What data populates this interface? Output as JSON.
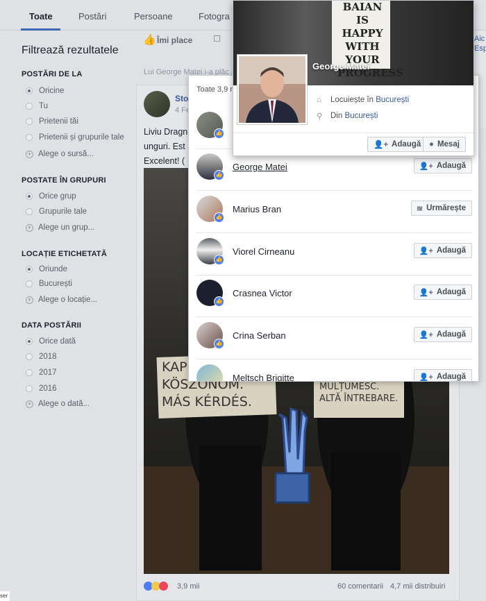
{
  "tabs": [
    "Toate",
    "Postări",
    "Persoane",
    "Fotogra"
  ],
  "sidebar": {
    "title": "Filtrează rezultatele",
    "sections": [
      {
        "heading": "POSTĂRI DE LA",
        "options": [
          "Oricine",
          "Tu",
          "Prietenii tăi",
          "Prietenii și grupurile tale"
        ],
        "more": "Alege o sursă..."
      },
      {
        "heading": "POSTATE ÎN GRUPURI",
        "options": [
          "Orice grup",
          "Grupurile tale"
        ],
        "more": "Alege un grup..."
      },
      {
        "heading": "LOCAȚIE ETICHETATĂ",
        "options": [
          "Oriunde",
          "București"
        ],
        "more": "Alege o locație..."
      },
      {
        "heading": "DATA POSTĂRII",
        "options": [
          "Orice dată",
          "2018",
          "2017",
          "2016"
        ],
        "more": "Alege o dată..."
      }
    ]
  },
  "post": {
    "like_label": "Îmi place",
    "shared_by": "Lui George Matei i-a plăc",
    "author_fragment": "Sto",
    "date_fragment": "4 Fe",
    "text_lines": [
      "Liviu Dragn",
      "unguri. Est",
      "Excelent! ("
    ],
    "sign_left": [
      "KAP",
      "KÖSZÖNÖM.",
      "MÁS KÉRDÉS."
    ],
    "sign_right": [
      "MULȚUMESC.",
      "ALTĂ ÎNTREBARE."
    ],
    "reactions_count": "3,9 mii",
    "comments": "60 comentarii",
    "shares": "4,7 mii distribuiri"
  },
  "right_column": {
    "line1": "Aic",
    "line2": "Esp"
  },
  "likers": {
    "tab_label": "Toate 3,9 m",
    "people": [
      {
        "name": "",
        "button": "",
        "variant": "partial"
      },
      {
        "name": "George Matei",
        "button": "Adaugă",
        "variant": "add"
      },
      {
        "name": "Marius Bran",
        "button": "Urmărește",
        "variant": "follow"
      },
      {
        "name": "Viorel Cirneanu",
        "button": "Adaugă",
        "variant": "add"
      },
      {
        "name": "Crasnea Victor",
        "button": "Adaugă",
        "variant": "add"
      },
      {
        "name": "Crina Serban",
        "button": "Adaugă",
        "variant": "add"
      },
      {
        "name": "Meltsch Brigitte",
        "button": "Adaugă",
        "variant": "add"
      }
    ]
  },
  "hover_card": {
    "name": "George Matei",
    "cover_text": [
      "BAIAN",
      "IS HAPPY",
      "WITH YOUR",
      "PROGRESS"
    ],
    "lives_prefix": "Locuiește în",
    "lives_city": "București",
    "from_prefix": "Din",
    "from_city": "București",
    "add_button": "Adaugă",
    "message_button": "Mesaj"
  },
  "corner_label": "ser",
  "colors": {
    "accent": "#4267b2",
    "reaction_blue": "#4a7ef1",
    "link": "#385898"
  }
}
